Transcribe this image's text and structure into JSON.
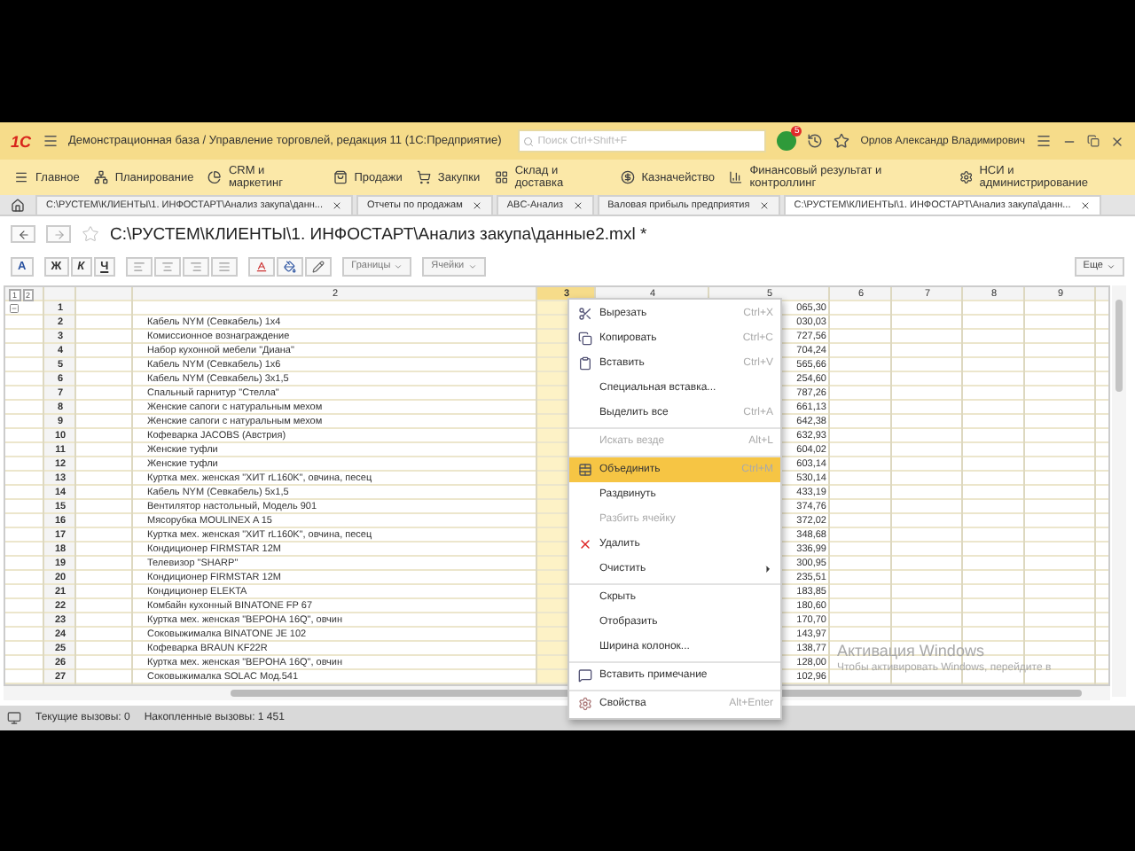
{
  "app": {
    "logo": "1С",
    "title": "Демонстрационная база / Управление торговлей, редакция 11  (1С:Предприятие)",
    "search": {
      "placeholder": "Поиск Ctrl+Shift+F"
    },
    "notifications": "5",
    "user": "Орлов Александр Владимирович"
  },
  "sections": [
    {
      "label": "Главное"
    },
    {
      "label": "Планирование"
    },
    {
      "label": "CRM и маркетинг"
    },
    {
      "label": "Продажи"
    },
    {
      "label": "Закупки"
    },
    {
      "label": "Склад и доставка"
    },
    {
      "label": "Казначейство"
    },
    {
      "label": "Финансовый результат и контроллинг"
    },
    {
      "label": "НСИ и администрирование"
    }
  ],
  "tabs": [
    {
      "label": "C:\\РУСТЕМ\\КЛИЕНТЫ\\1. ИНФОСТАРТ\\Анализ закупа\\данн...",
      "selected": false
    },
    {
      "label": "Отчеты по продажам",
      "selected": false
    },
    {
      "label": "ABC-Анализ",
      "selected": false
    },
    {
      "label": "Валовая прибыль предприятия",
      "selected": false
    },
    {
      "label": "C:\\РУСТЕМ\\КЛИЕНТЫ\\1. ИНФОСТАРТ\\Анализ закупа\\данн...",
      "selected": true
    }
  ],
  "document": {
    "title": "C:\\РУСТЕМ\\КЛИЕНТЫ\\1. ИНФОСТАРТ\\Анализ закупа\\данные2.mxl *",
    "favorite": false
  },
  "toolbar": {
    "font_button": "A",
    "format_buttons": [
      "Ж",
      "К",
      "Ч"
    ],
    "dropdowns": [
      "Границы",
      "Ячейки"
    ],
    "more": "Еще"
  },
  "sheet": {
    "outline_levels": [
      "1",
      "2"
    ],
    "columns": [
      {
        "label": "2",
        "selected": false
      },
      {
        "label": "3",
        "selected": true
      },
      {
        "label": "4",
        "selected": false
      },
      {
        "label": "5",
        "selected": false
      },
      {
        "label": "6",
        "selected": false
      },
      {
        "label": "7",
        "selected": false
      },
      {
        "label": "8",
        "selected": false
      },
      {
        "label": "9",
        "selected": false
      }
    ],
    "rows": [
      {
        "number": "1",
        "value": "065,30",
        "expanded": true
      },
      {
        "number": "2",
        "name": "Кабель NYM (Севкабель) 1х4",
        "value": "030,03"
      },
      {
        "number": "3",
        "name": "Комиссионное вознаграждение",
        "value": "727,56"
      },
      {
        "number": "4",
        "name": "Набор кухонной мебели \"Диана\"",
        "value": "704,24"
      },
      {
        "number": "5",
        "name": "Кабель NYM (Севкабель) 1х6",
        "value": "565,66"
      },
      {
        "number": "6",
        "name": "Кабель NYM (Севкабель) 3х1,5",
        "value": "254,60"
      },
      {
        "number": "7",
        "name": "Спальный гарнитур \"Стелла\"",
        "value": "787,26"
      },
      {
        "number": "8",
        "name": "Женские сапоги с натуральным мехом",
        "value": "661,13"
      },
      {
        "number": "9",
        "name": "Женские сапоги с натуральным мехом",
        "value": "642,38"
      },
      {
        "number": "10",
        "name": "Кофеварка JACOBS (Австрия)",
        "value": "632,93"
      },
      {
        "number": "11",
        "name": "Женские туфли",
        "value": "604,02"
      },
      {
        "number": "12",
        "name": "Женские туфли",
        "value": "603,14"
      },
      {
        "number": "13",
        "name": "Куртка мех. женская \"ХИТ rL160K\", овчина, песец",
        "value": "530,14"
      },
      {
        "number": "14",
        "name": "Кабель NYM (Севкабель) 5х1,5",
        "value": "433,19"
      },
      {
        "number": "15",
        "name": "Вентилятор настольный, Модель 901",
        "value": "374,76"
      },
      {
        "number": "16",
        "name": "Мясорубка MOULINEX  A 15",
        "value": "372,02"
      },
      {
        "number": "17",
        "name": "Куртка мех. женская \"ХИТ rL160K\", овчина, песец",
        "value": "348,68"
      },
      {
        "number": "18",
        "name": "Кондиционер FIRMSTAR 12M",
        "value": "336,99"
      },
      {
        "number": "19",
        "name": "Телевизор \"SHARP\"",
        "value": "300,95"
      },
      {
        "number": "20",
        "name": "Кондиционер FIRMSTAR 12M",
        "value": "235,51"
      },
      {
        "number": "21",
        "name": "Кондиционер ELEKTA",
        "value": "183,85"
      },
      {
        "number": "22",
        "name": "Комбайн кухонный BINATONE FP 67",
        "value": "180,60"
      },
      {
        "number": "23",
        "name": "Куртка мех. женская \"ВЕРОНА 16Q\", овчин",
        "value": "170,70"
      },
      {
        "number": "24",
        "name": "Соковыжималка  BINATONE JE 102",
        "value": "143,97"
      },
      {
        "number": "25",
        "name": "Кофеварка BRAUN KF22R",
        "value": "138,77"
      },
      {
        "number": "26",
        "name": "Куртка мех. женская \"ВЕРОНА 16Q\", овчин",
        "value": "128,00"
      },
      {
        "number": "27",
        "name": "Соковыжималка  SOLAC  Мод.541",
        "value": "102,96"
      }
    ]
  },
  "context_menu": {
    "items": [
      {
        "kind": "item",
        "label": "Вырезать",
        "shortcut": "Ctrl+X",
        "disabled": false,
        "selected": false
      },
      {
        "kind": "item",
        "label": "Копировать",
        "shortcut": "Ctrl+C",
        "disabled": false,
        "selected": false
      },
      {
        "kind": "item",
        "label": "Вставить",
        "shortcut": "Ctrl+V",
        "disabled": false,
        "selected": false
      },
      {
        "kind": "item",
        "label": "Специальная вставка...",
        "disabled": false,
        "selected": false
      },
      {
        "kind": "item",
        "label": "Выделить все",
        "shortcut": "Ctrl+A",
        "disabled": false,
        "selected": false
      },
      {
        "kind": "separator"
      },
      {
        "kind": "item",
        "label": "Искать везде",
        "shortcut": "Alt+L",
        "disabled": true,
        "selected": false
      },
      {
        "kind": "separator"
      },
      {
        "kind": "item",
        "label": "Объединить",
        "shortcut": "Ctrl+M",
        "disabled": false,
        "selected": true
      },
      {
        "kind": "item",
        "label": "Раздвинуть",
        "disabled": false,
        "selected": false
      },
      {
        "kind": "item",
        "label": "Разбить ячейку",
        "disabled": true,
        "selected": false
      },
      {
        "kind": "item",
        "label": "Удалить",
        "disabled": false,
        "selected": false
      },
      {
        "kind": "submenu",
        "label": "Очистить",
        "disabled": false,
        "selected": false
      },
      {
        "kind": "separator"
      },
      {
        "kind": "item",
        "label": "Скрыть",
        "disabled": false,
        "selected": false
      },
      {
        "kind": "item",
        "label": "Отобразить",
        "disabled": false,
        "selected": false
      },
      {
        "kind": "item",
        "label": "Ширина колонок...",
        "disabled": false,
        "selected": false
      },
      {
        "kind": "separator"
      },
      {
        "kind": "item",
        "label": "Вставить примечание",
        "disabled": false,
        "selected": false
      },
      {
        "kind": "separator"
      },
      {
        "kind": "item",
        "label": "Свойства",
        "shortcut": "Alt+Enter",
        "disabled": false,
        "selected": false
      }
    ]
  },
  "status_bar": {
    "current": "Текущие вызовы: 0",
    "accumulated": "Накопленные вызовы: 1 451"
  },
  "activation": {
    "title": "Активация Windows",
    "text": "Чтобы активировать Windows, перейдите в"
  }
}
